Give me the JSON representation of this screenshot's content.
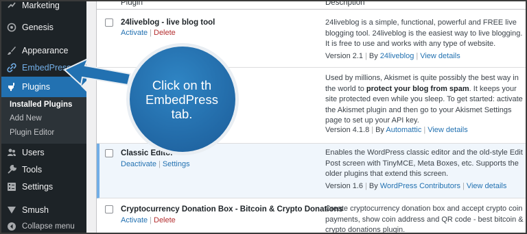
{
  "sidebar": {
    "items": [
      {
        "label": "Marketing",
        "icon": "marketing-icon"
      },
      {
        "label": "Genesis",
        "icon": "genesis-icon"
      },
      {
        "label": "Appearance",
        "icon": "appearance-icon"
      },
      {
        "label": "EmbedPress",
        "icon": "embedpress-icon"
      },
      {
        "label": "Plugins",
        "icon": "plugins-icon"
      },
      {
        "label": "Users",
        "icon": "users-icon"
      },
      {
        "label": "Tools",
        "icon": "tools-icon"
      },
      {
        "label": "Settings",
        "icon": "settings-icon"
      },
      {
        "label": "Smush",
        "icon": "smush-icon"
      },
      {
        "label": "Collapse menu",
        "icon": "collapse-icon"
      }
    ],
    "submenu": [
      "Installed Plugins",
      "Add New",
      "Plugin Editor"
    ]
  },
  "table": {
    "col_plugin": "Plugin",
    "col_description": "Description"
  },
  "plugins": [
    {
      "name": "24liveblog - live blog tool",
      "action1": "Activate",
      "action2": "Delete",
      "desc": "24liveblog is a simple, functional, powerful and FREE live blogging tool. 24liveblog is the easiest way to live blogging. It is free to use and works with any type of website.",
      "version": "Version 2.1",
      "by": "By",
      "author": "24liveblog",
      "details": "View details"
    },
    {
      "desc_1": "Used by millions, Akismet is quite possibly the best way in the world to ",
      "desc_bold": "protect your blog from spam",
      "desc_2": ". It keeps your site protected even while you sleep. To get started: activate the Akismet plugin and then go to your Akismet Settings page to set up your API key.",
      "version": "Version 4.1.8",
      "by": "By",
      "author": "Automattic",
      "details": "View details"
    },
    {
      "name": "Classic Editor",
      "action1": "Deactivate",
      "action2": "Settings",
      "desc": "Enables the WordPress classic editor and the old-style Edit Post screen with TinyMCE, Meta Boxes, etc. Supports the older plugins that extend this screen.",
      "version": "Version 1.6",
      "by": "By",
      "author": "WordPress Contributors",
      "details": "View details"
    },
    {
      "name": "Cryptocurrency Donation Box - Bitcoin & Crypto Donations",
      "action1": "Activate",
      "action2": "Delete",
      "desc": "Create cryptocurrency donation box and accept crypto coin payments, show coin address and QR code - best bitcoin & crypto donations plugin."
    }
  ],
  "callout": {
    "line1": "Click on th",
    "line2": "EmbedPress",
    "line3": "tab."
  },
  "colors": {
    "sidebar_bg": "#1d2327",
    "accent": "#2271b1",
    "callout": "#2673ae",
    "delete": "#b32d2e"
  }
}
